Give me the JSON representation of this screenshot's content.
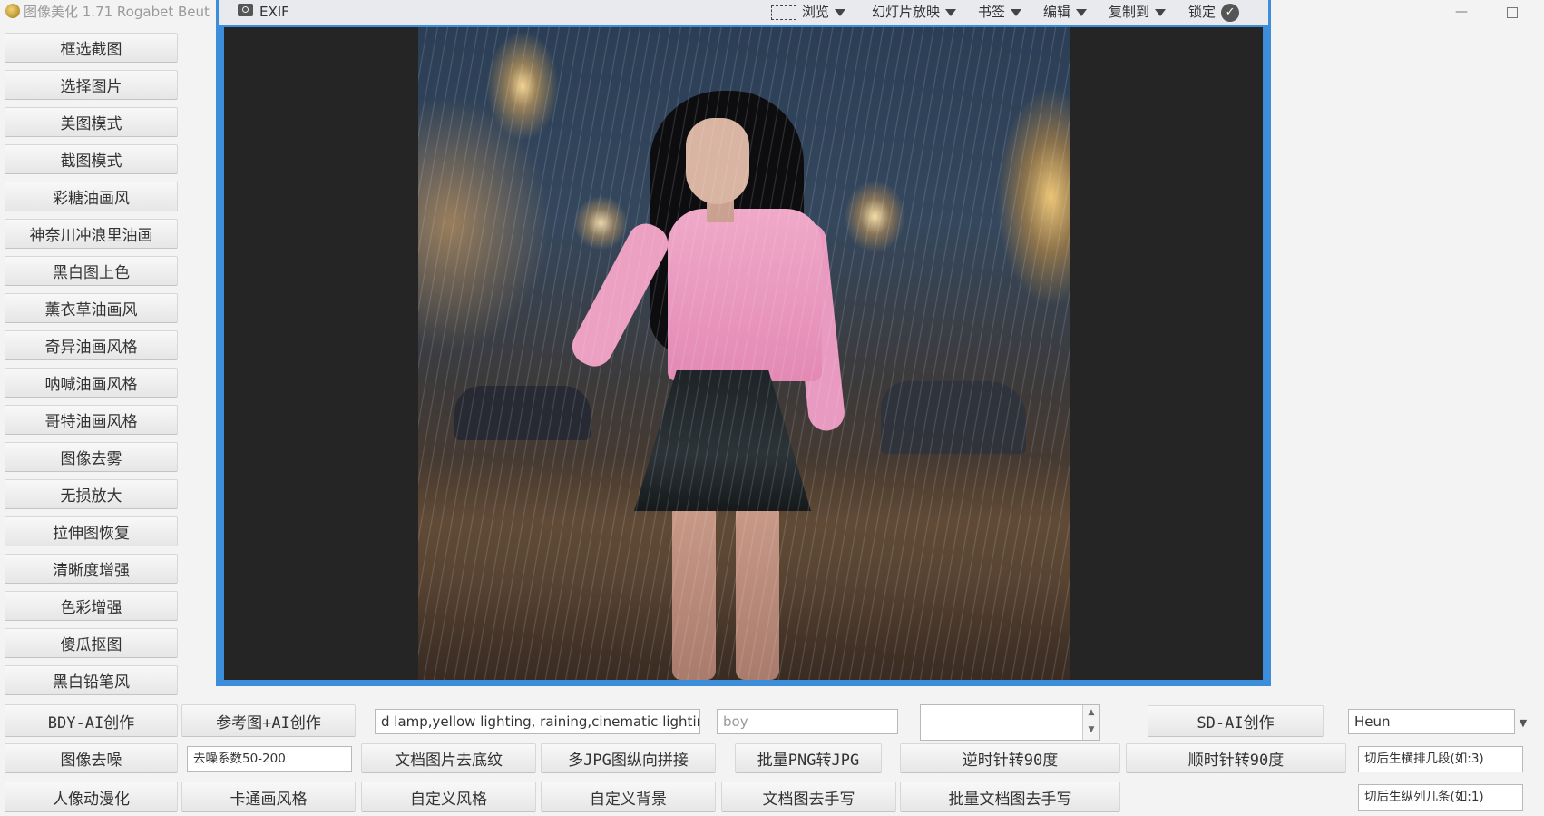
{
  "window": {
    "title": "图像美化 1.71 Rogabet Beut",
    "minimize_glyph": "—"
  },
  "viewer_toolbar": {
    "exif": "EXIF",
    "browse": "浏览",
    "slideshow": "幻灯片放映",
    "bookmarks": "书签",
    "edit": "编辑",
    "copy_to": "复制到",
    "lock": "锁定"
  },
  "sidebar": {
    "items": [
      "框选截图",
      "选择图片",
      "美图模式",
      "截图模式",
      "彩糖油画风",
      "神奈川冲浪里油画",
      "黑白图上色",
      "薰衣草油画风",
      "奇异油画风格",
      "呐喊油画风格",
      "哥特油画风格",
      "图像去雾",
      "无损放大",
      "拉伸图恢复",
      "清晰度增强",
      "色彩增强",
      "傻瓜抠图",
      "黑白铅笔风"
    ]
  },
  "row1": {
    "bdy_ai": "BDY-AI创作",
    "ref_ai": "参考图+AI创作",
    "prompt_value": "d lamp,yellow lighting, raining,cinematic lighting",
    "negative_value": "boy",
    "spin_value": "",
    "sd_ai": "SD-AI创作",
    "sampler_value": "Heun"
  },
  "row2": {
    "denoise": "图像去噪",
    "denoise_param": "去噪系数50-200",
    "doc_remove_texture": "文档图片去底纹",
    "multi_jpg_stitch": "多JPG图纵向拼接",
    "batch_png_jpg": "批量PNG转JPG",
    "rotate_ccw": "逆时针转90度",
    "rotate_cw": "顺时针转90度",
    "cut_rows_placeholder": "切后生横排几段(如:3)"
  },
  "row3": {
    "portrait_anime": "人像动漫化",
    "cartoon_style": "卡通画风格",
    "custom_style": "自定义风格",
    "custom_background": "自定义背景",
    "doc_remove_handwriting": "文档图去手写",
    "batch_doc_remove_handwriting": "批量文档图去手写",
    "cut_cols_placeholder": "切后生纵列几条(如:1)"
  },
  "colors": {
    "viewer_border": "#3c8edb",
    "canvas_bg": "#252526",
    "window_bg": "#f3f3f3"
  }
}
